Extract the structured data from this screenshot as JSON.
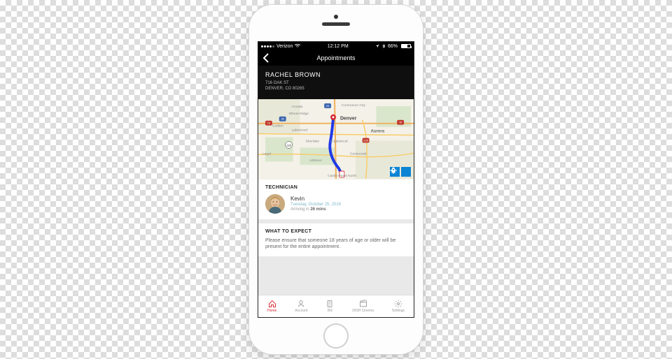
{
  "statusbar": {
    "carrier": "Verizon",
    "time": "12:12 PM",
    "battery": "66%"
  },
  "navbar": {
    "title": "Appointments"
  },
  "customer": {
    "name": "RACHEL BROWN",
    "address1": "716 OAK ST",
    "address2": "DENVER, CO 80265"
  },
  "map": {
    "destination_label": "Denver",
    "nearby_labels": [
      "Arvada",
      "Commerce City",
      "Wheat Ridge",
      "Golden",
      "Lakewood",
      "Aurora",
      "Sheridan",
      "Englewood",
      "Legal",
      "Centennial",
      "Littleton",
      "Castle Pines North"
    ],
    "highway_shields": [
      "25",
      "36",
      "70",
      "70",
      "285",
      "225"
    ]
  },
  "technician": {
    "section_title": "TECHNICIAN",
    "name": "Kevin",
    "date": "Tuesday, October 25, 2016",
    "arrival_prefix": "Arriving in ",
    "arrival_time": "26 mins"
  },
  "expect": {
    "section_title": "WHAT TO EXPECT",
    "body": "Please ensure that someone 18 years of age or older will be present for the entire appointment."
  },
  "tabs": {
    "home": "Home",
    "account": "Account",
    "bill": "Bill",
    "cinema": "DISH Cinema",
    "settings": "Settings"
  }
}
